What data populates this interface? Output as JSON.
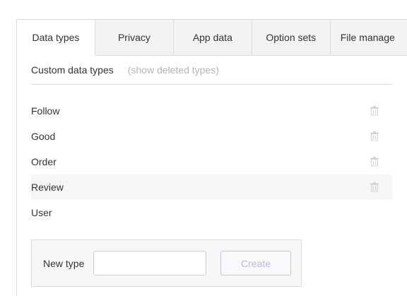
{
  "tabs": [
    {
      "label": "Data types",
      "active": true
    },
    {
      "label": "Privacy",
      "active": false
    },
    {
      "label": "App data",
      "active": false
    },
    {
      "label": "Option sets",
      "active": false
    },
    {
      "label": "File manage",
      "active": false
    }
  ],
  "section": {
    "title": "Custom data types",
    "show_deleted_label": "(show deleted types)"
  },
  "types": [
    {
      "name": "Follow",
      "icon": "trash-icon"
    },
    {
      "name": "Good",
      "icon": "trash-icon"
    },
    {
      "name": "Order",
      "icon": "trash-icon"
    },
    {
      "name": "Review",
      "icon": "trash-icon",
      "highlighted": true
    },
    {
      "name": "User"
    }
  ],
  "new_type": {
    "label": "New type",
    "input_value": "",
    "create_label": "Create"
  },
  "colors": {
    "border": "#dcdcdc",
    "tab_inactive_bg": "#f2f2f2",
    "muted_text": "#b5b5b5",
    "create_border": "#c3c3e6",
    "create_text": "#b9b9d6"
  }
}
